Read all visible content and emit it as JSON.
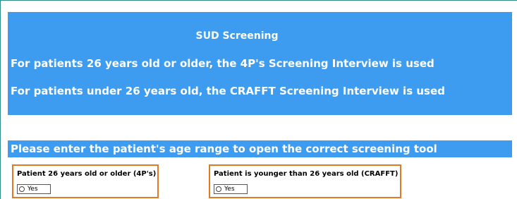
{
  "banner": {
    "title": "SUD Screening",
    "line1": "For patients 26 years old or older, the 4P's Screening Interview is used",
    "line2": "For patients under 26 years old, the CRAFFT Screening Interview is used"
  },
  "prompt": "Please enter the patient's age range to open the correct screening tool",
  "choices": [
    {
      "label": "Patient 26 years old or older (4P's)",
      "option": "Yes",
      "selected": false
    },
    {
      "label": "Patient is younger than 26 years old (CRAFFT)",
      "option": "Yes",
      "selected": false
    }
  ],
  "colors": {
    "banner_blue": "#3d9cf0",
    "highlight_orange": "#e07a25"
  }
}
